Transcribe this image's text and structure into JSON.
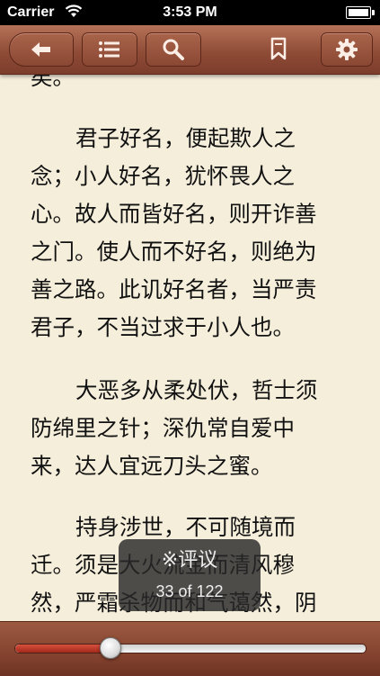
{
  "status_bar": {
    "carrier": "Carrier",
    "time": "3:53 PM"
  },
  "toolbar": {
    "icons": [
      "back-arrow-icon",
      "list-icon",
      "search-icon",
      "bookmark-icon",
      "gear-icon"
    ]
  },
  "content": {
    "lines": [
      "矣。",
      "君子好名，便起欺人之",
      "念；小人好名，犹怀畏人之",
      "心。故人而皆好名，则开诈善",
      "之门。使人而不好名，则绝为",
      "善之路。此讥好名者，当严责",
      "君子，不当过求于小人也。",
      "大恶多从柔处伏，哲士须",
      "防绵里之针；深仇常自爱中",
      "来，达人宜远刀头之蜜。",
      "持身涉世，不可随境而",
      "迁。须是大火流金而清风穆",
      "然，严霜杀物而和气蔼然，阴"
    ]
  },
  "popup": {
    "title": "※评议",
    "page": "33 of 122"
  },
  "progress": {
    "fraction": 0.27
  },
  "colors": {
    "toolbar": "#8f4c37",
    "paper": "#f5eedb",
    "slider_fill": "#c0392b"
  }
}
